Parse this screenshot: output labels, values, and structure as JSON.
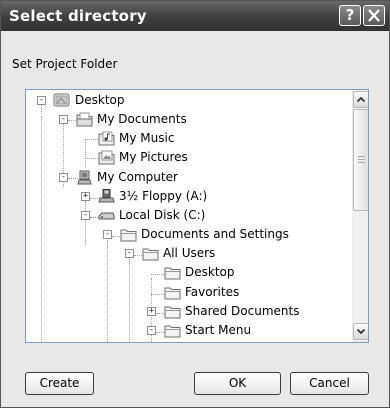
{
  "window": {
    "title": "Select directory",
    "help_label": "?",
    "subtitle": "Set Project Folder"
  },
  "tree": {
    "nodes": [
      {
        "label": "Desktop",
        "icon": "desktop-icon",
        "toggle": "-"
      },
      {
        "label": "My Documents",
        "icon": "folder-documents-icon",
        "toggle": "-"
      },
      {
        "label": "My Music",
        "icon": "folder-music-icon",
        "toggle": ""
      },
      {
        "label": "My Pictures",
        "icon": "folder-pictures-icon",
        "toggle": ""
      },
      {
        "label": "My Computer",
        "icon": "computer-icon",
        "toggle": "-"
      },
      {
        "label": "3½ Floppy (A:)",
        "icon": "floppy-drive-icon",
        "toggle": "+"
      },
      {
        "label": "Local Disk (C:)",
        "icon": "hard-disk-icon",
        "toggle": "-"
      },
      {
        "label": "Documents and Settings",
        "icon": "folder-icon",
        "toggle": "-"
      },
      {
        "label": "All Users",
        "icon": "folder-icon",
        "toggle": "-"
      },
      {
        "label": "Desktop",
        "icon": "folder-icon",
        "toggle": ""
      },
      {
        "label": "Favorites",
        "icon": "folder-icon",
        "toggle": ""
      },
      {
        "label": "Shared Documents",
        "icon": "folder-icon",
        "toggle": "+"
      },
      {
        "label": "Start Menu",
        "icon": "folder-icon",
        "toggle": "-"
      }
    ]
  },
  "buttons": {
    "create": "Create",
    "ok": "OK",
    "cancel": "Cancel"
  },
  "colors": {
    "titlebar": "#3e3e3e",
    "tree_border": "#7f9db9",
    "folder": "#f3e6a9"
  }
}
